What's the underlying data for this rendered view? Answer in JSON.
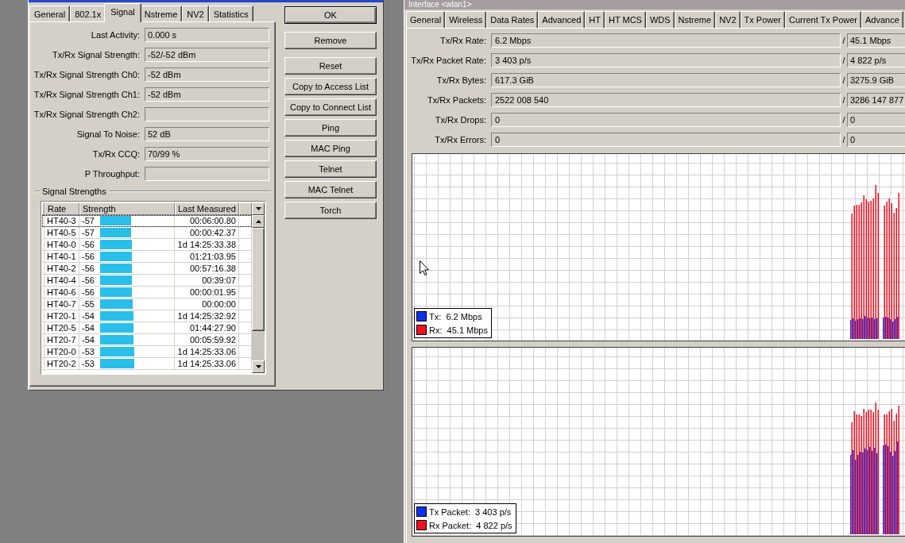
{
  "signal_dialog": {
    "tabs": [
      {
        "label": "General",
        "selected": false
      },
      {
        "label": "802.1x",
        "selected": false
      },
      {
        "label": "Signal",
        "selected": true
      },
      {
        "label": "Nstreme",
        "selected": false
      },
      {
        "label": "NV2",
        "selected": false
      },
      {
        "label": "Statistics",
        "selected": false
      }
    ],
    "fields": [
      {
        "label": "Last Activity:",
        "value": "0.000 s"
      },
      {
        "label": "Tx/Rx Signal Strength:",
        "value": "-52/-52 dBm"
      },
      {
        "label": "Tx/Rx Signal Strength Ch0:",
        "value": "-52 dBm"
      },
      {
        "label": "Tx/Rx Signal Strength Ch1:",
        "value": "-52 dBm"
      },
      {
        "label": "Tx/Rx Signal Strength Ch2:"
      },
      {
        "label": "Signal To Noise:",
        "value": "52 dB"
      },
      {
        "label": "Tx/Rx CCQ:",
        "value": "70/99 %"
      },
      {
        "label": "P Throughput:"
      }
    ],
    "signal_strengths": {
      "title": "Signal Strengths",
      "columns": [
        "Rate",
        "Strength",
        "Last Measured"
      ],
      "rows": [
        {
          "rate": "HT40-3",
          "strength": "-57",
          "level": 0.42,
          "last_measured": "00:06:00.80",
          "selected": true
        },
        {
          "rate": "HT40-5",
          "strength": "-57",
          "level": 0.42,
          "last_measured": "00:00:42.37",
          "selected": false
        },
        {
          "rate": "HT40-0",
          "strength": "-56",
          "level": 0.43,
          "last_measured": "1d 14:25:33.38",
          "selected": false
        },
        {
          "rate": "HT40-1",
          "strength": "-56",
          "level": 0.43,
          "last_measured": "01:21:03.95",
          "selected": false
        },
        {
          "rate": "HT40-2",
          "strength": "-56",
          "level": 0.43,
          "last_measured": "00:57:16.38",
          "selected": false
        },
        {
          "rate": "HT40-4",
          "strength": "-56",
          "level": 0.43,
          "last_measured": "00:39:07",
          "selected": false
        },
        {
          "rate": "HT40-6",
          "strength": "-56",
          "level": 0.43,
          "last_measured": "00:00:01.95",
          "selected": false
        },
        {
          "rate": "HT40-7",
          "strength": "-55",
          "level": 0.45,
          "last_measured": "00:00:00",
          "selected": false
        },
        {
          "rate": "HT20-1",
          "strength": "-54",
          "level": 0.46,
          "last_measured": "1d 14:25:32.92",
          "selected": false
        },
        {
          "rate": "HT20-5",
          "strength": "-54",
          "level": 0.46,
          "last_measured": "01:44:27.90",
          "selected": false
        },
        {
          "rate": "HT20-7",
          "strength": "-54",
          "level": 0.46,
          "last_measured": "00:05:59.92",
          "selected": false
        },
        {
          "rate": "HT20-0",
          "strength": "-53",
          "level": 0.47,
          "last_measured": "1d 14:25:33.06",
          "selected": false
        },
        {
          "rate": "HT20-2",
          "strength": "-53",
          "level": 0.47,
          "last_measured": "1d 14:25:33.06",
          "selected": false
        }
      ]
    },
    "buttons": [
      {
        "label": "OK",
        "default": true
      },
      {
        "label": "Remove",
        "default": false
      },
      {
        "label": "Reset",
        "default": false
      },
      {
        "label": "Copy to Access List",
        "default": false
      },
      {
        "label": "Copy to Connect List",
        "default": false
      },
      {
        "label": "Ping",
        "default": false
      },
      {
        "label": "MAC Ping",
        "default": false
      },
      {
        "label": "Telnet",
        "default": false
      },
      {
        "label": "MAC Telnet",
        "default": false
      },
      {
        "label": "Torch",
        "default": false
      }
    ]
  },
  "interface_window": {
    "title": "Interface <wlan1>",
    "tabs": [
      {
        "label": "General",
        "selected": false
      },
      {
        "label": "Wireless",
        "selected": false
      },
      {
        "label": "Data Rates",
        "selected": false
      },
      {
        "label": "Advanced",
        "selected": false
      },
      {
        "label": "HT",
        "selected": false
      },
      {
        "label": "HT MCS",
        "selected": false
      },
      {
        "label": "WDS",
        "selected": false
      },
      {
        "label": "Nstreme",
        "selected": false
      },
      {
        "label": "NV2",
        "selected": false
      },
      {
        "label": "Tx Power",
        "selected": false
      },
      {
        "label": "Current Tx Power",
        "selected": false
      },
      {
        "label": "Advance",
        "selected": false
      }
    ],
    "fields": [
      {
        "label": "Tx/Rx Rate:",
        "tx": "6.2 Mbps",
        "separator": "/",
        "rx": "45.1 Mbps"
      },
      {
        "label": "Tx/Rx Packet Rate:",
        "tx": "3 403 p/s",
        "separator": "/",
        "rx": "4 822 p/s"
      },
      {
        "label": "Tx/Rx Bytes:",
        "tx": "617.3 GiB",
        "separator": "/",
        "rx": "3275.9 GiB"
      },
      {
        "label": "Tx/Rx Packets:",
        "tx": "2522 008 540",
        "separator": "/",
        "rx": "3286 147 877"
      },
      {
        "label": "Tx/Rx Drops:",
        "tx": "0",
        "separator": "/",
        "rx": "0"
      },
      {
        "label": "Tx/Rx Errors:",
        "tx": "0",
        "separator": "/",
        "rx": "0"
      }
    ],
    "charts": [
      {
        "legend": [
          {
            "label": "Tx:  6.2 Mbps",
            "color": "#1030f0"
          },
          {
            "label": "Rx:  45.1 Mbps",
            "color": "#f01020"
          }
        ]
      },
      {
        "legend": [
          {
            "label": "Tx Packet:  3 403 p/s",
            "color": "#1030f0"
          },
          {
            "label": "Rx Packet:  4 822 p/s",
            "color": "#f01020"
          }
        ]
      }
    ]
  }
}
